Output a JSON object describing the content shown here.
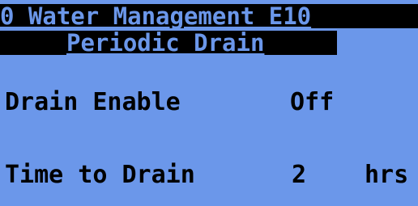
{
  "header": {
    "title": "0 Water Management E10",
    "subtitle": "Periodic Drain"
  },
  "params": [
    {
      "label": "Drain Enable",
      "value": "Off",
      "unit": ""
    },
    {
      "label": "Time to Drain",
      "value": "2",
      "unit": "hrs"
    }
  ],
  "colors": {
    "background": "#6b97ea",
    "text": "#000000"
  }
}
